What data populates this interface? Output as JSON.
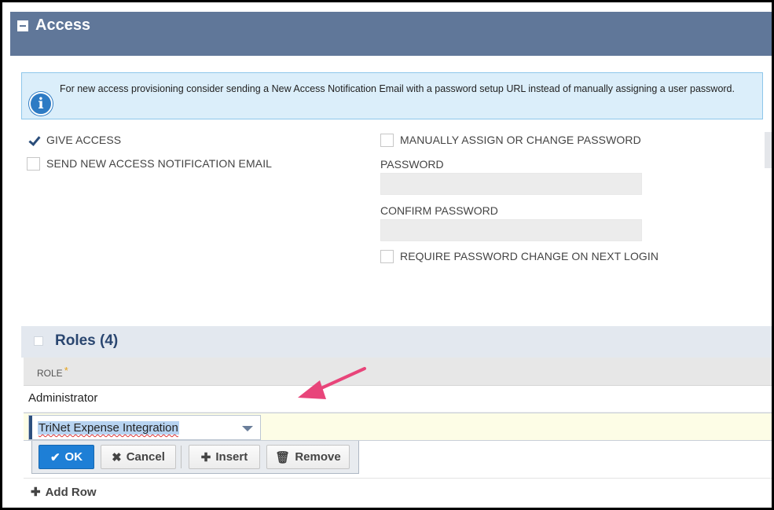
{
  "access": {
    "title": "Access"
  },
  "info_banner": {
    "text": "For new access provisioning consider sending a New Access Notification Email with a password setup URL instead of manually assigning a user password.",
    "icon": "info-icon"
  },
  "left_options": {
    "give_access": {
      "label": "GIVE ACCESS",
      "checked": true
    },
    "send_email": {
      "label": "SEND NEW ACCESS NOTIFICATION EMAIL",
      "checked": false
    }
  },
  "right_options": {
    "manual_password": {
      "label": "MANUALLY ASSIGN OR CHANGE PASSWORD",
      "checked": false
    },
    "password_label": "PASSWORD",
    "confirm_password_label": "CONFIRM PASSWORD",
    "require_change": {
      "label": "REQUIRE PASSWORD CHANGE ON NEXT LOGIN",
      "checked": false
    }
  },
  "roles": {
    "title": "Roles (4)",
    "column_role": "ROLE",
    "required_marker": "*",
    "rows": [
      "Administrator"
    ],
    "editing_value": "TriNet Expense Integration",
    "buttons": {
      "ok": "OK",
      "cancel": "Cancel",
      "insert": "Insert",
      "remove": "Remove"
    },
    "add_row": "Add Row"
  },
  "colors": {
    "header_bg": "#607799",
    "banner_bg": "#dbeefa",
    "ok_button": "#1e7fd6",
    "annotation_arrow": "#e8457a",
    "edit_row_bg": "#fdfde6"
  }
}
